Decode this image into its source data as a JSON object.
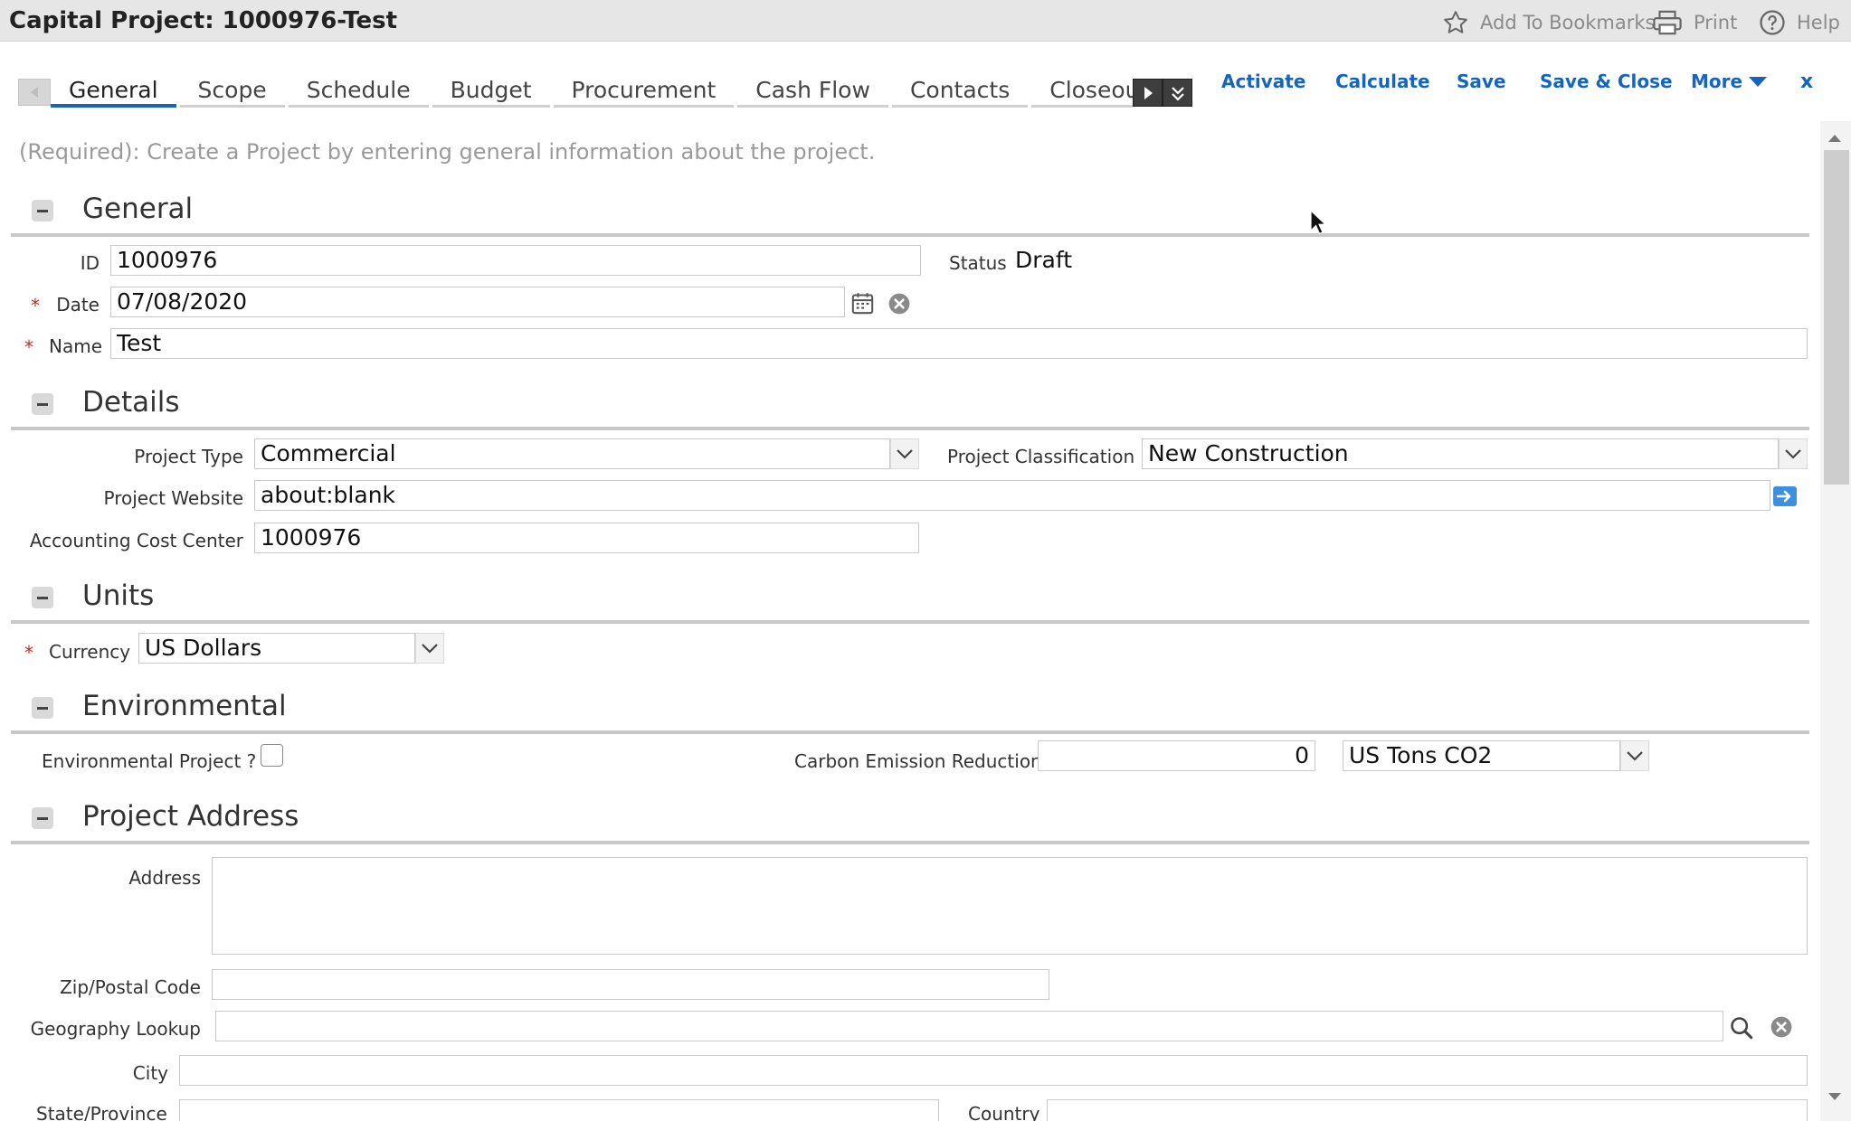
{
  "header": {
    "title": "Capital Project: 1000976-Test",
    "bookmark_label": "Add To Bookmarks",
    "print_label": "Print",
    "help_label": "Help"
  },
  "tabs": [
    "General",
    "Scope",
    "Schedule",
    "Budget",
    "Procurement",
    "Cash Flow",
    "Contacts",
    "Closeou"
  ],
  "actions": {
    "activate": "Activate",
    "calculate": "Calculate",
    "save": "Save",
    "save_close": "Save & Close",
    "more": "More",
    "close": "x"
  },
  "intro": "(Required): Create a Project by entering general information about the project.",
  "general": {
    "title": "General",
    "id_label": "ID",
    "id_value": "1000976",
    "status_label": "Status",
    "status_value": "Draft",
    "date_label": "Date",
    "date_value": "07/08/2020",
    "name_label": "Name",
    "name_value": "Test"
  },
  "details": {
    "title": "Details",
    "project_type_label": "Project Type",
    "project_type_value": "Commercial",
    "classification_label": "Project Classification",
    "classification_value": "New Construction",
    "website_label": "Project Website",
    "website_value": "about:blank",
    "cost_center_label": "Accounting Cost Center",
    "cost_center_value": "1000976"
  },
  "units": {
    "title": "Units",
    "currency_label": "Currency",
    "currency_value": "US Dollars"
  },
  "environmental": {
    "title": "Environmental",
    "env_project_label": "Environmental Project ?",
    "carbon_label": "Carbon Emission Reduction",
    "carbon_value": "0",
    "carbon_unit": "US Tons CO2"
  },
  "address": {
    "title": "Project Address",
    "address_label": "Address",
    "zip_label": "Zip/Postal Code",
    "geo_label": "Geography Lookup",
    "city_label": "City",
    "state_label": "State/Province",
    "country_label": "Country"
  },
  "required_mark": "*"
}
